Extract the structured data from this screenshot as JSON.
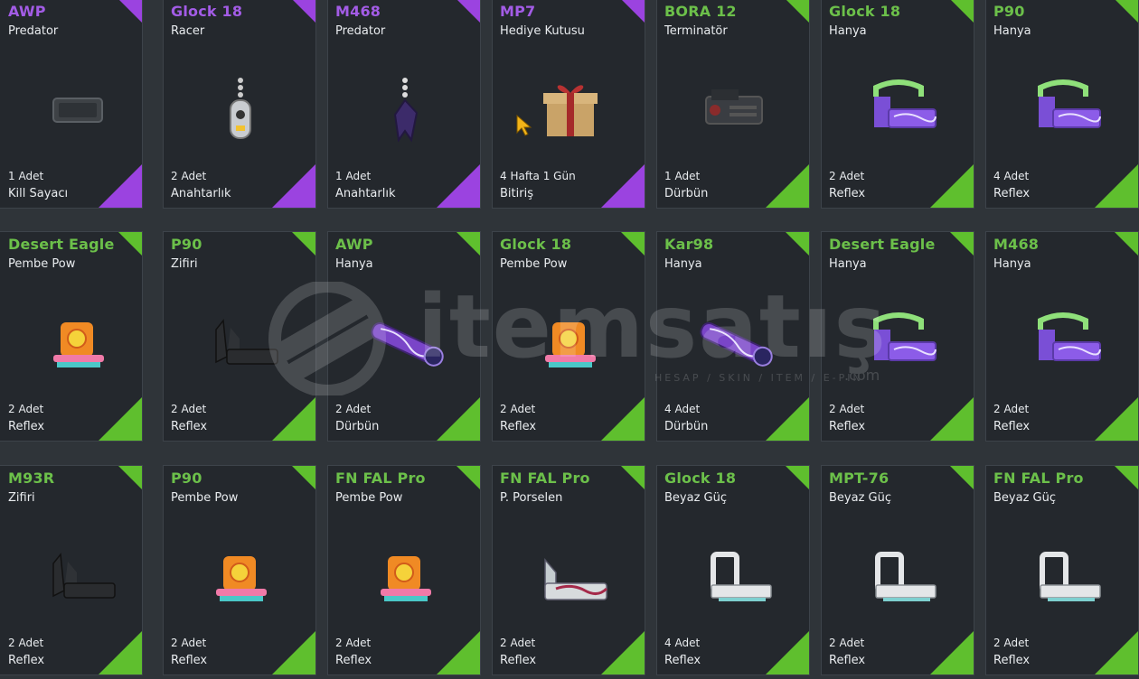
{
  "watermark": {
    "brand": "itemsatış",
    "tagline": "HESAP / SKIN / ITEM / E-PIN",
    "suffix": ".com"
  },
  "colors": {
    "purple_rarity": "#9b43e0",
    "green_rarity": "#5fbf2e",
    "card_bg": "#24282d",
    "page_bg": "#2f3439"
  },
  "cards": [
    {
      "weapon": "AWP",
      "skin": "Predator",
      "qty": "1 Adet",
      "category": "Kill Sayacı",
      "rarity": "purple",
      "icon": "kill-counter-icon"
    },
    {
      "weapon": "Glock 18",
      "skin": "Racer",
      "qty": "2 Adet",
      "category": "Anahtarlık",
      "rarity": "purple",
      "icon": "keychain-racer-icon"
    },
    {
      "weapon": "M468",
      "skin": "Predator",
      "qty": "1 Adet",
      "category": "Anahtarlık",
      "rarity": "purple",
      "icon": "keychain-predator-icon"
    },
    {
      "weapon": "MP7",
      "skin": "Hediye Kutusu",
      "qty": "4 Hafta 1 Gün",
      "category": "Bitiriş",
      "rarity": "purple",
      "icon": "gift-box-icon"
    },
    {
      "weapon": "BORA 12",
      "skin": "Terminatör",
      "qty": "1 Adet",
      "category": "Dürbün",
      "rarity": "green",
      "icon": "scope-terminator-icon"
    },
    {
      "weapon": "Glock 18",
      "skin": "Hanya",
      "qty": "2 Adet",
      "category": "Reflex",
      "rarity": "green",
      "icon": "reflex-hanya-icon"
    },
    {
      "weapon": "P90",
      "skin": "Hanya",
      "qty": "4 Adet",
      "category": "Reflex",
      "rarity": "green",
      "icon": "reflex-hanya-icon"
    },
    {
      "weapon": "Desert Eagle",
      "skin": "Pembe Pow",
      "qty": "2 Adet",
      "category": "Reflex",
      "rarity": "green",
      "icon": "reflex-pembe-pow-icon"
    },
    {
      "weapon": "P90",
      "skin": "Zifiri",
      "qty": "2 Adet",
      "category": "Reflex",
      "rarity": "green",
      "icon": "reflex-zifiri-icon"
    },
    {
      "weapon": "AWP",
      "skin": "Hanya",
      "qty": "2 Adet",
      "category": "Dürbün",
      "rarity": "green",
      "icon": "scope-hanya-icon"
    },
    {
      "weapon": "Glock 18",
      "skin": "Pembe Pow",
      "qty": "2 Adet",
      "category": "Reflex",
      "rarity": "green",
      "icon": "reflex-pembe-pow-icon"
    },
    {
      "weapon": "Kar98",
      "skin": "Hanya",
      "qty": "4 Adet",
      "category": "Dürbün",
      "rarity": "green",
      "icon": "scope-hanya-icon"
    },
    {
      "weapon": "Desert Eagle",
      "skin": "Hanya",
      "qty": "2 Adet",
      "category": "Reflex",
      "rarity": "green",
      "icon": "reflex-hanya-icon"
    },
    {
      "weapon": "M468",
      "skin": "Hanya",
      "qty": "2 Adet",
      "category": "Reflex",
      "rarity": "green",
      "icon": "reflex-hanya-icon"
    },
    {
      "weapon": "M93R",
      "skin": "Zifiri",
      "qty": "2 Adet",
      "category": "Reflex",
      "rarity": "green",
      "icon": "reflex-zifiri-icon"
    },
    {
      "weapon": "P90",
      "skin": "Pembe Pow",
      "qty": "2 Adet",
      "category": "Reflex",
      "rarity": "green",
      "icon": "reflex-pembe-pow-icon"
    },
    {
      "weapon": "FN FAL Pro",
      "skin": "Pembe Pow",
      "qty": "2 Adet",
      "category": "Reflex",
      "rarity": "green",
      "icon": "reflex-pembe-pow-icon"
    },
    {
      "weapon": "FN FAL Pro",
      "skin": "P. Porselen",
      "qty": "2 Adet",
      "category": "Reflex",
      "rarity": "green",
      "icon": "reflex-porselen-icon"
    },
    {
      "weapon": "Glock 18",
      "skin": "Beyaz Güç",
      "qty": "4 Adet",
      "category": "Reflex",
      "rarity": "green",
      "icon": "reflex-beyaz-guc-icon"
    },
    {
      "weapon": "MPT-76",
      "skin": "Beyaz Güç",
      "qty": "2 Adet",
      "category": "Reflex",
      "rarity": "green",
      "icon": "reflex-beyaz-guc-icon"
    },
    {
      "weapon": "FN FAL Pro",
      "skin": "Beyaz Güç",
      "qty": "2 Adet",
      "category": "Reflex",
      "rarity": "green",
      "icon": "reflex-beyaz-guc-icon"
    }
  ]
}
